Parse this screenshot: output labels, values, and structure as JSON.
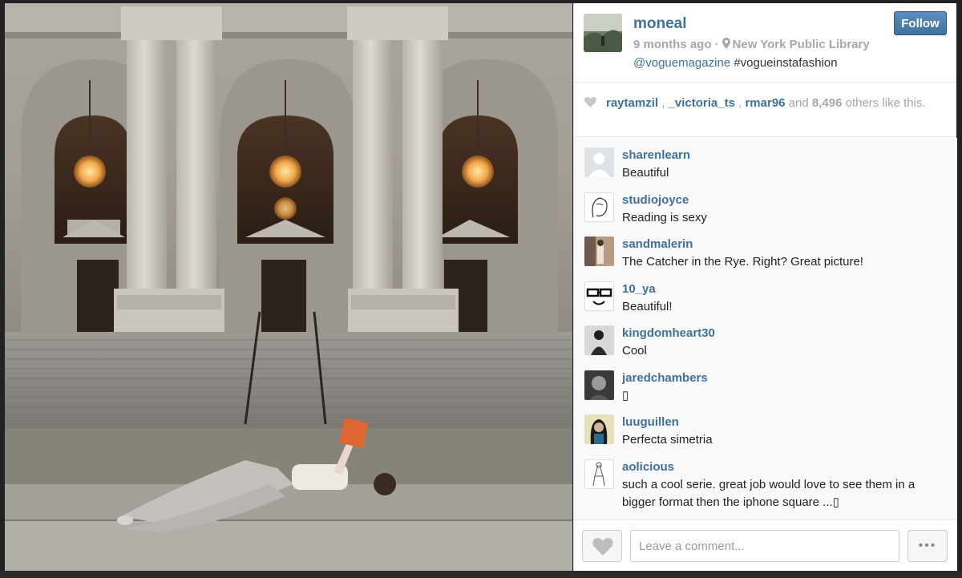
{
  "post": {
    "author": "moneal",
    "time": "9 months ago",
    "location": "New York Public Library",
    "caption_mention": "@voguemagazine",
    "caption_tag": "#vogueinstafashion",
    "follow_label": "Follow"
  },
  "likes": {
    "likers": [
      "raytamzil",
      "_victoria_ts",
      "rmar96"
    ],
    "sep1": " , ",
    "sep2": " , ",
    "and_text": " and ",
    "count": "8,496",
    "suffix": " others like this."
  },
  "comments": [
    {
      "user": "sharenlearn",
      "text": "Beautiful"
    },
    {
      "user": "studiojoyce",
      "text": "Reading is sexy"
    },
    {
      "user": "sandmalerin",
      "text": "The Catcher in the Rye. Right? Great picture!"
    },
    {
      "user": "10_ya",
      "text": "Beautiful!"
    },
    {
      "user": "kingdomheart30",
      "text": "Cool"
    },
    {
      "user": "jaredchambers",
      "text": "▯"
    },
    {
      "user": "luuguillen",
      "text": "Perfecta simetria"
    },
    {
      "user": "aolicious",
      "text": "such a cool serie. great job would love to see them in a bigger format then the iphone square ...▯"
    }
  ],
  "composer": {
    "placeholder": "Leave a comment...",
    "more_label": "•••"
  },
  "icons": {
    "heart": "heart-icon",
    "pin": "location-pin-icon",
    "more": "more-dots-icon"
  },
  "colors": {
    "link": "#3f729b",
    "meta": "#a5a7aa",
    "follow": "#3f729b"
  }
}
